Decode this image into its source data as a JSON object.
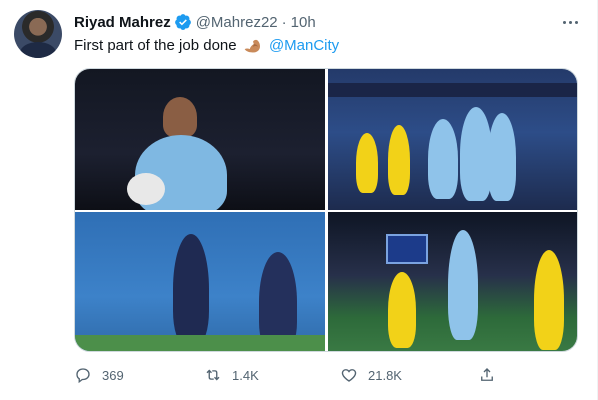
{
  "tweet": {
    "author_name": "Riyad Mahrez",
    "handle": "@Mahrez22",
    "separator": "·",
    "time": "10h",
    "text": "First part of the job done",
    "emoji": "flexed-biceps",
    "mention": "@ManCity"
  },
  "media": {
    "count": 4
  },
  "actions": {
    "reply_count": "369",
    "retweet_count": "1.4K",
    "like_count": "21.8K"
  },
  "icons": [
    "verified-badge-icon",
    "more-icon",
    "reply-icon",
    "retweet-icon",
    "like-icon",
    "share-icon"
  ],
  "colors": {
    "accent": "#1d9bf0",
    "secondary_text": "#536471",
    "primary_text": "#0f1419"
  }
}
